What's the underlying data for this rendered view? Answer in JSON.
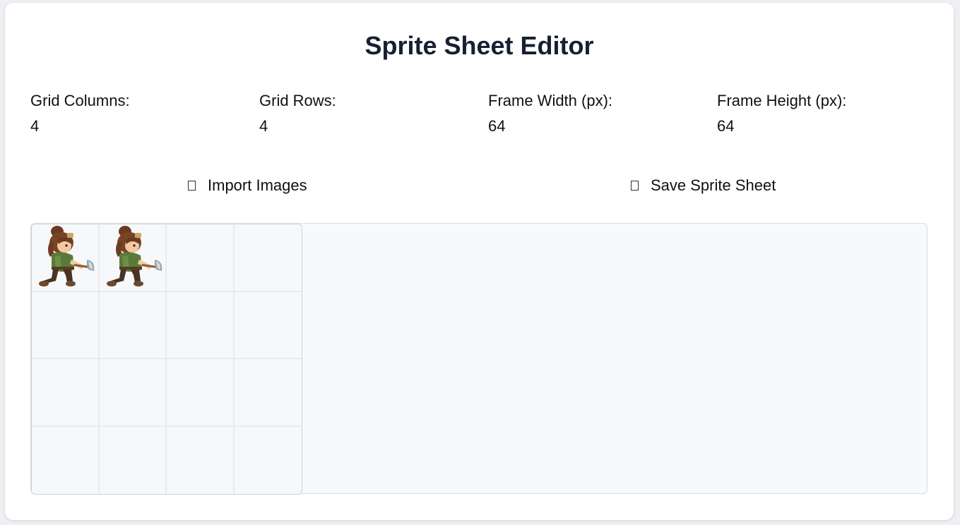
{
  "app": {
    "title": "Sprite Sheet Editor"
  },
  "settings": {
    "columns": {
      "label": "Grid Columns:",
      "value": "4"
    },
    "rows": {
      "label": "Grid Rows:",
      "value": "4"
    },
    "frame_width": {
      "label": "Frame Width (px):",
      "value": "64"
    },
    "frame_height": {
      "label": "Frame Height (px):",
      "value": "64"
    }
  },
  "actions": {
    "import_label": "Import Images",
    "save_label": "Save Sprite Sheet"
  },
  "grid": {
    "columns": 4,
    "rows": 4,
    "filled_cells": 2,
    "sprite_icon": "woodcutter-axe-sprite"
  },
  "colors": {
    "title": "#172033",
    "canvas_bg": "#f8f9fb",
    "grid_line": "#e8eaee"
  }
}
